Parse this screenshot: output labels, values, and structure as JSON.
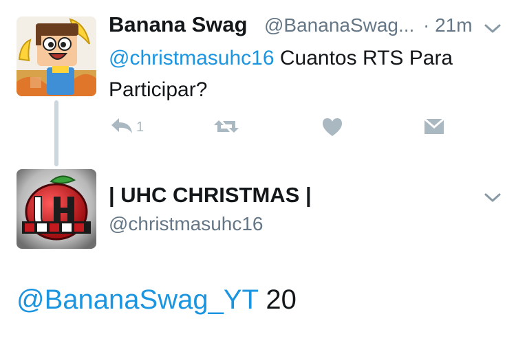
{
  "original_tweet": {
    "display_name": "Banana Swag",
    "handle": "@BananaSwag...",
    "time": "· 21m",
    "text_mention": "@christmasuhc16",
    "text_body": " Cuantos RTS Para Participar?",
    "actions": {
      "reply_icon": "reply-icon",
      "reply_count": "1",
      "retweet_icon": "retweet-icon",
      "like_icon": "heart-icon",
      "dm_icon": "envelope-icon"
    }
  },
  "reply_tweet": {
    "display_name": "| UHC CHRISTMAS |",
    "handle": "@christmasuhc16",
    "text_mention": "@BananaSwag_YT",
    "text_body": " 20"
  },
  "colors": {
    "link": "#1b95e0",
    "text": "#14171a",
    "muted": "#657786",
    "icon": "#aab8c2",
    "thread_line": "#ccd6dd"
  }
}
